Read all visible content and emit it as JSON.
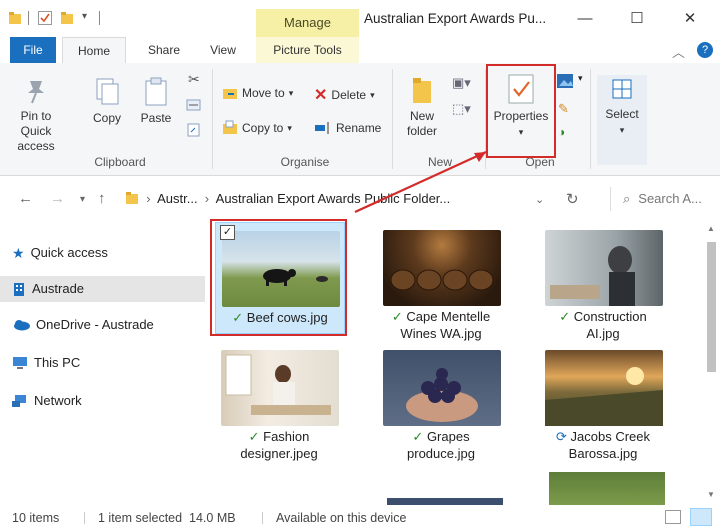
{
  "window": {
    "title": "Australian Export Awards Pu...",
    "context_tab": "Manage",
    "minimize_glyph": "—",
    "maximize_glyph": "☐",
    "close_glyph": "✕"
  },
  "tabs": [
    "File",
    "Home",
    "Share",
    "View",
    "Picture Tools"
  ],
  "ribbon": {
    "clipboard": {
      "label": "Clipboard",
      "pin_label_1": "Pin to Quick",
      "pin_label_2": "access",
      "copy": "Copy",
      "paste": "Paste"
    },
    "organise": {
      "label": "Organise",
      "move_to": "Move to",
      "copy_to": "Copy to",
      "delete": "Delete",
      "rename": "Rename"
    },
    "new": {
      "label": "New",
      "new_folder_1": "New",
      "new_folder_2": "folder"
    },
    "open": {
      "label": "Open",
      "properties": "Properties"
    },
    "select": {
      "select": "Select"
    }
  },
  "address": {
    "crumb_1": "Austr...",
    "crumb_2": "Australian Export Awards Public Folder...",
    "search_placeholder": "Search A..."
  },
  "nav_pane": [
    {
      "label": "Quick access",
      "icon": "star-icon"
    },
    {
      "label": "Austrade",
      "icon": "building-icon"
    },
    {
      "label": "OneDrive - Austrade",
      "icon": "cloud-icon"
    },
    {
      "label": "This PC",
      "icon": "computer-icon"
    },
    {
      "label": "Network",
      "icon": "network-icon"
    }
  ],
  "files": [
    {
      "line1": "Beef cows.jpg",
      "line2": "",
      "status": "✓",
      "selected": true
    },
    {
      "line1": "Cape Mentelle",
      "line2": "Wines WA.jpg",
      "status": "✓"
    },
    {
      "line1": "Construction",
      "line2": "AI.jpg",
      "status": "✓"
    },
    {
      "line1": "Fashion",
      "line2": "designer.jpeg",
      "status": "✓"
    },
    {
      "line1": "Grapes",
      "line2": "produce.jpg",
      "status": "✓"
    },
    {
      "line1": "Jacobs Creek",
      "line2": "Barossa.jpg",
      "status": "⟳"
    }
  ],
  "status": {
    "items": "10 items",
    "selected": "1 item selected  14.0 MB",
    "availability": "Available on this device"
  },
  "colors": {
    "accent": "#1a6fbe",
    "annotation": "#d32a2a",
    "manage_bg": "#f6f0a6",
    "selection": "#cde8fb"
  }
}
